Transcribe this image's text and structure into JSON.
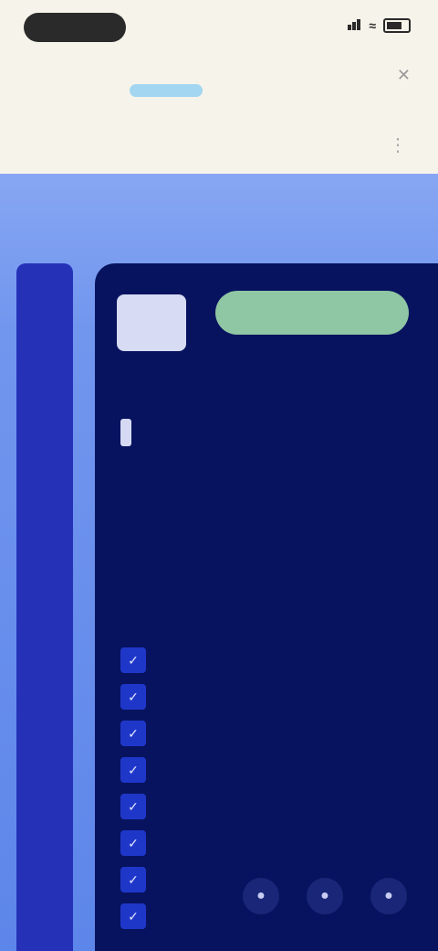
{
  "status_bar": {
    "time": "",
    "signal_icon": "signal-icon",
    "wifi_icon": "wifi-icon",
    "battery_icon": "battery-icon"
  },
  "browser": {
    "url": "",
    "close_icon": "close-icon"
  },
  "site": {
    "logo_text": "",
    "menu_icon": "menu-icon"
  },
  "card": {
    "logo_label": "",
    "badge_label": "",
    "eyebrow": "",
    "title_plain": "",
    "title_highlight": "",
    "description": "",
    "description_2": "",
    "features": [
      {
        "icon": "check-icon",
        "label": ""
      },
      {
        "icon": "check-icon",
        "label": ""
      },
      {
        "icon": "check-icon",
        "label": ""
      },
      {
        "icon": "check-icon",
        "label": ""
      },
      {
        "icon": "check-icon",
        "label": ""
      },
      {
        "icon": "check-icon",
        "label": ""
      },
      {
        "icon": "check-icon",
        "label": ""
      },
      {
        "icon": "check-icon",
        "label": ""
      }
    ],
    "social_icons": [
      "social-icon",
      "social-icon",
      "social-icon"
    ]
  },
  "colors": {
    "page_bg": "#f6f3ea",
    "hero_gradient_top": "#87a6f3",
    "hero_gradient_bottom": "#5d86ea",
    "rail": "#2532b8",
    "card_bg": "#08135f",
    "badge": "#8fc6a3",
    "url_accent": "#8fd0f2",
    "brand": "#4450c8"
  }
}
